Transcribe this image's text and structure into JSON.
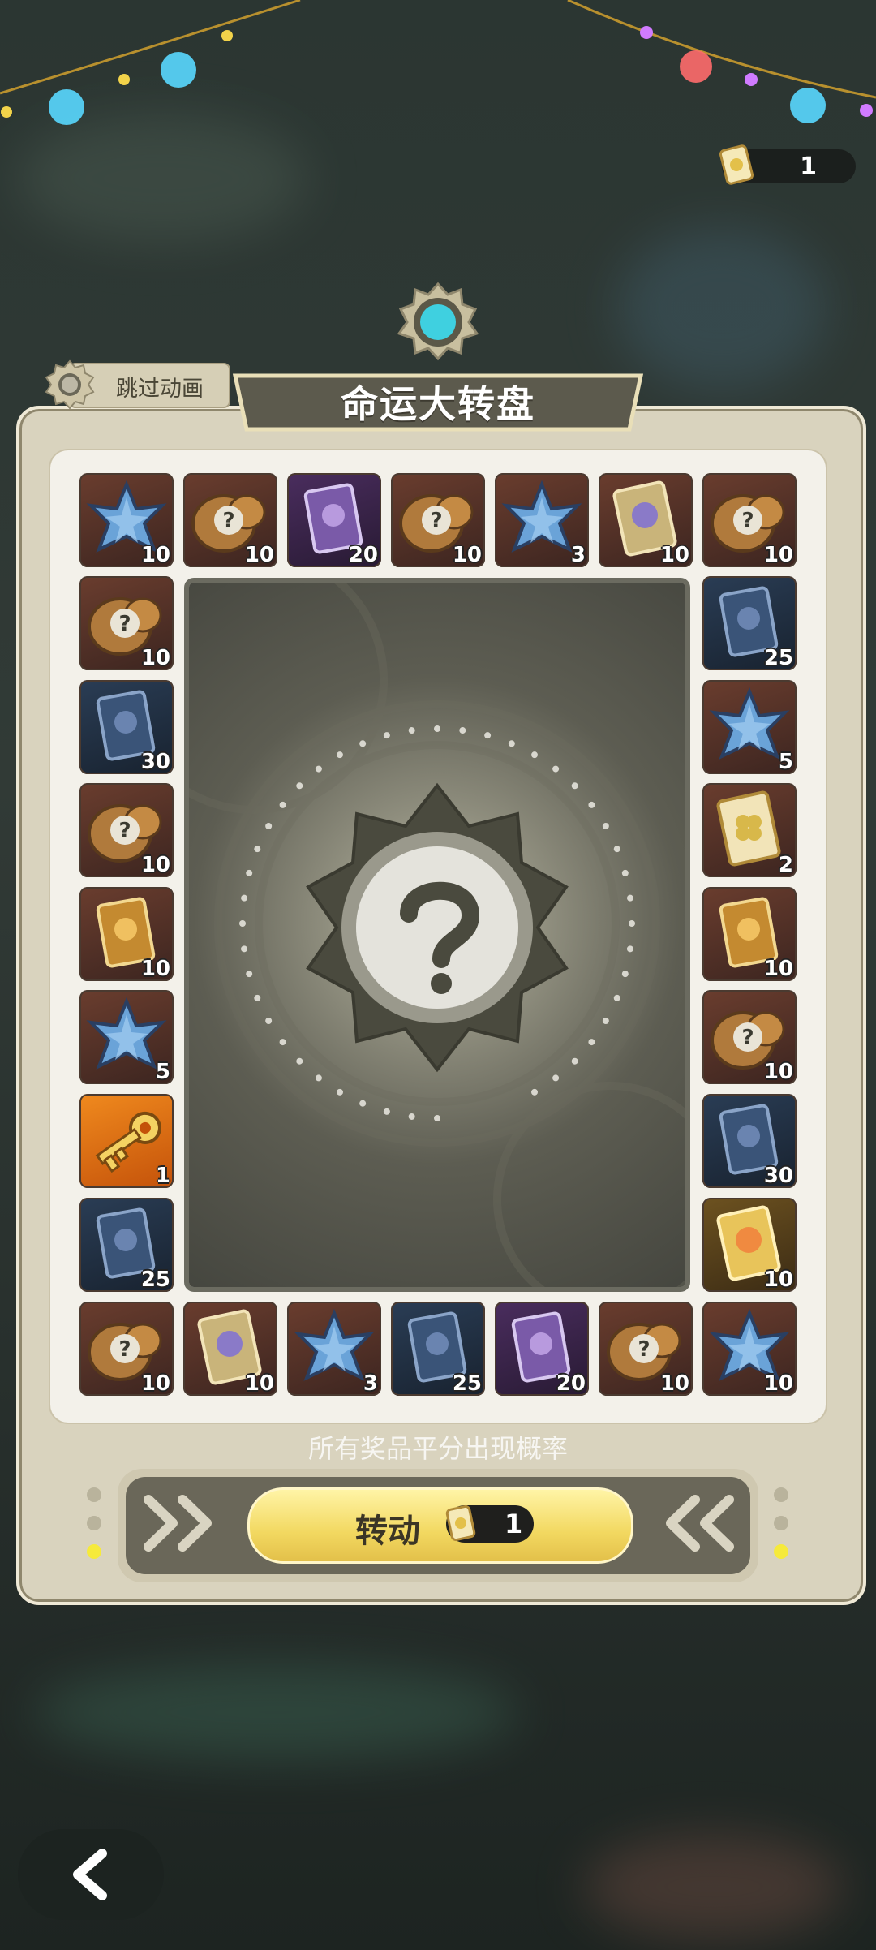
{
  "header": {
    "ticket_count": "1",
    "ticket_icon": "ticket-icon"
  },
  "wheel": {
    "title": "命运大转盘",
    "skip_label": "跳过动画",
    "center_icon": "question-mark-icon",
    "rate_note": "所有奖品平分出现概率",
    "spin_label": "转动",
    "spin_cost": "1"
  },
  "colors": {
    "accent_yellow": "#f2d860",
    "panel": "#d9d3be",
    "inner": "#f3f1ea",
    "ticket_teal": "#3fd0e0"
  },
  "prizes": [
    {
      "type": "star-shard",
      "count": "10"
    },
    {
      "type": "mystery-bag",
      "count": "10"
    },
    {
      "type": "purple-card",
      "count": "20"
    },
    {
      "type": "mystery-bag",
      "count": "10"
    },
    {
      "type": "star-shard",
      "count": "3"
    },
    {
      "type": "character-card",
      "count": "10"
    },
    {
      "type": "mystery-bag",
      "count": "10"
    },
    {
      "type": "blue-card",
      "count": "25"
    },
    {
      "type": "star-shard",
      "count": "5"
    },
    {
      "type": "clover-card",
      "count": "2"
    },
    {
      "type": "orange-card",
      "count": "10"
    },
    {
      "type": "mystery-bag",
      "count": "10"
    },
    {
      "type": "blue-card",
      "count": "30"
    },
    {
      "type": "gold-card",
      "count": "10"
    },
    {
      "type": "star-shard",
      "count": "10"
    },
    {
      "type": "mystery-bag",
      "count": "10"
    },
    {
      "type": "purple-card",
      "count": "20"
    },
    {
      "type": "blue-card",
      "count": "25"
    },
    {
      "type": "star-shard",
      "count": "3"
    },
    {
      "type": "character-card",
      "count": "10"
    },
    {
      "type": "mystery-bag",
      "count": "10"
    },
    {
      "type": "blue-card",
      "count": "25"
    },
    {
      "type": "golden-key",
      "count": "1"
    },
    {
      "type": "star-shard",
      "count": "5"
    },
    {
      "type": "orange-card",
      "count": "10"
    },
    {
      "type": "mystery-bag",
      "count": "10"
    },
    {
      "type": "blue-card",
      "count": "30"
    },
    {
      "type": "mystery-bag",
      "count": "10"
    }
  ]
}
